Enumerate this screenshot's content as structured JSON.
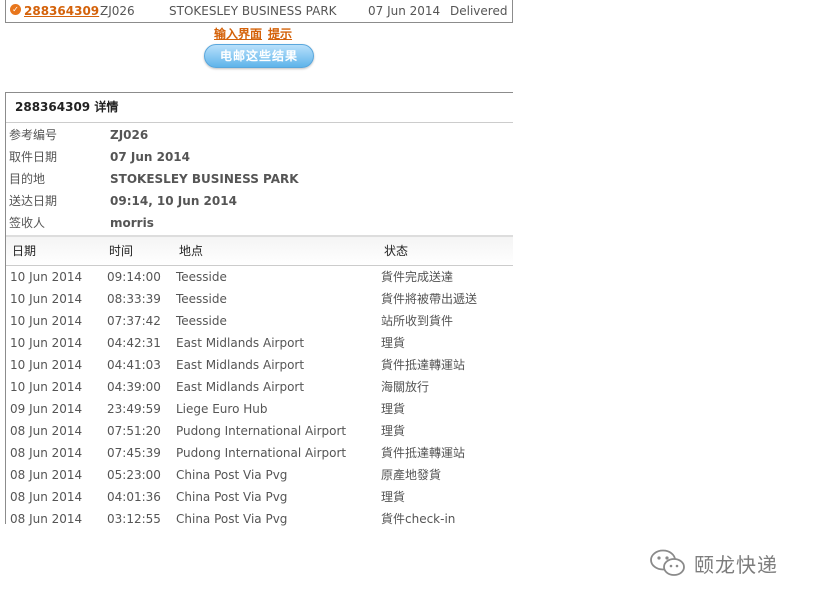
{
  "summary": {
    "tracking_number": "288364309",
    "reference": "ZJ026",
    "destination": "STOKESLEY BUSINESS PARK",
    "date": "07 Jun 2014",
    "status": "Delivered",
    "status_icon": "checkmark-icon"
  },
  "links": {
    "input_screen": "输入界面",
    "hint": "提示"
  },
  "email_button_label": "电邮这些结果",
  "details": {
    "title": "288364309 详情",
    "fields": [
      {
        "label": "参考编号",
        "value": "ZJ026"
      },
      {
        "label": "取件日期",
        "value": "07 Jun 2014"
      },
      {
        "label": "目的地",
        "value": "STOKESLEY BUSINESS PARK"
      },
      {
        "label": "送达日期",
        "value": "09:14, 10 Jun 2014"
      },
      {
        "label": "签收人",
        "value": "morris"
      }
    ],
    "columns": {
      "date": "日期",
      "time": "时间",
      "location": "地点",
      "status": "状态"
    },
    "events": [
      {
        "date": "10 Jun 2014",
        "time": "09:14:00",
        "location": "Teesside",
        "status": "貨件完成送達"
      },
      {
        "date": "10 Jun 2014",
        "time": "08:33:39",
        "location": "Teesside",
        "status": "貨件將被帶出遞送"
      },
      {
        "date": "10 Jun 2014",
        "time": "07:37:42",
        "location": "Teesside",
        "status": "站所收到貨件"
      },
      {
        "date": "10 Jun 2014",
        "time": "04:42:31",
        "location": "East Midlands Airport",
        "status": "理貨"
      },
      {
        "date": "10 Jun 2014",
        "time": "04:41:03",
        "location": "East Midlands Airport",
        "status": "貨件抵達轉運站"
      },
      {
        "date": "10 Jun 2014",
        "time": "04:39:00",
        "location": "East Midlands Airport",
        "status": "海關放行"
      },
      {
        "date": "09 Jun 2014",
        "time": "23:49:59",
        "location": "Liege Euro Hub",
        "status": "理貨"
      },
      {
        "date": "08 Jun 2014",
        "time": "07:51:20",
        "location": "Pudong International Airport",
        "status": "理貨"
      },
      {
        "date": "08 Jun 2014",
        "time": "07:45:39",
        "location": "Pudong International Airport",
        "status": "貨件抵達轉運站"
      },
      {
        "date": "08 Jun 2014",
        "time": "05:23:00",
        "location": "China Post Via Pvg",
        "status": "原產地發貨"
      },
      {
        "date": "08 Jun 2014",
        "time": "04:01:36",
        "location": "China Post Via Pvg",
        "status": "理貨"
      },
      {
        "date": "08 Jun 2014",
        "time": "03:12:55",
        "location": "China Post Via Pvg",
        "status": "貨件check-in"
      }
    ]
  },
  "watermark": {
    "text": "颐龙快递",
    "icon": "wechat-icon"
  },
  "colors": {
    "link": "#d4620a",
    "button_top": "#b9e0fb",
    "button_bottom": "#5fb4ea",
    "border": "#8c8c8c",
    "text": "#555555"
  }
}
